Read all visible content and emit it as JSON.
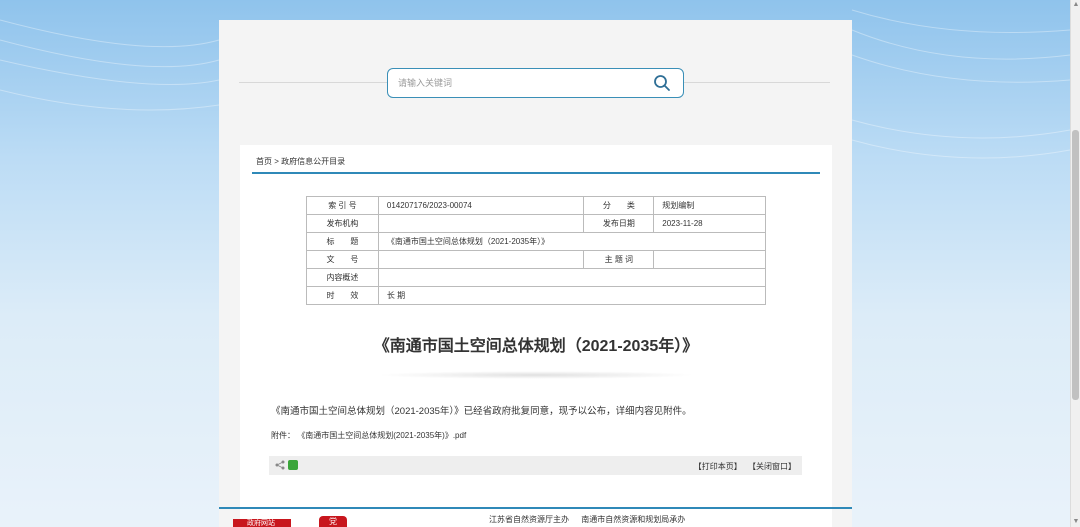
{
  "search": {
    "placeholder": "请输入关键词"
  },
  "breadcrumb": {
    "home": "首页",
    "sep": ">",
    "current": "政府信息公开目录"
  },
  "meta_table": {
    "rows": [
      {
        "label": "索 引 号",
        "value": "014207176/2023-00074",
        "label2": "分　　类",
        "value2": "规划编制"
      },
      {
        "label": "发布机构",
        "value": "",
        "label2": "发布日期",
        "value2": "2023-11-28"
      },
      {
        "label": "标　　题",
        "value": "《南通市国土空间总体规划（2021-2035年）》"
      },
      {
        "label": "文　　号",
        "value": "",
        "label2": "主 题 词",
        "value2": ""
      },
      {
        "label": "内容概述",
        "value": ""
      },
      {
        "label": "时　　效",
        "value": "长 期"
      }
    ]
  },
  "document": {
    "title": "《南通市国土空间总体规划（2021-2035年）》",
    "body": "《南通市国土空间总体规划（2021-2035年）》已经省政府批复同意，现予以公布，详细内容见附件。",
    "attachment_label": "附件：",
    "attachment_name": "《南通市国土空间总体规划(2021-2035年)》.pdf"
  },
  "toolbar": {
    "print": "【打印本页】",
    "close": "【关闭窗口】"
  },
  "footer": {
    "links": [
      "江苏省自然资源厅主办",
      "南通市自然资源和规划局承办"
    ],
    "logo1_text": "政府网站",
    "logo2_text": "党"
  },
  "colors": {
    "accent": "#2f89b8",
    "search_border": "#3a8fb7"
  }
}
